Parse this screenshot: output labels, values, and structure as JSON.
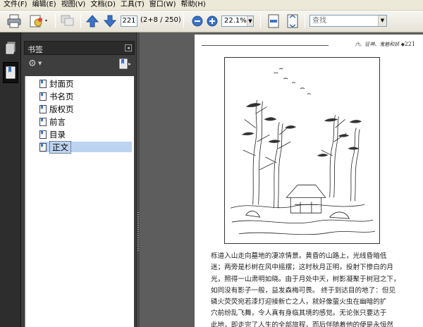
{
  "menu": [
    "文件(F)",
    "编辑(E)",
    "视图(V)",
    "文档(D)",
    "工具(T)",
    "窗口(W)",
    "帮助(H)"
  ],
  "toolbar": {
    "page_number": "221",
    "page_count": "(2+8 / 250)",
    "zoom": "22.1%",
    "search_placeholder": "查找"
  },
  "panel": {
    "title": "书签",
    "bookmarks": [
      {
        "label": "封面页",
        "selected": false
      },
      {
        "label": "书名页",
        "selected": false
      },
      {
        "label": "版权页",
        "selected": false
      },
      {
        "label": "前言",
        "selected": false
      },
      {
        "label": "目录",
        "selected": false
      },
      {
        "label": "正文",
        "selected": true
      }
    ]
  },
  "document": {
    "running_head": "六、征神、鬼魅和妖 ◆",
    "page_number": "221",
    "body_lines": [
      "栎道入山走向墓地的凄凉情景。黄昏的山路上，光线昏暗低",
      "迷；两旁是杉树在风中摇摆；这时秋月正明，投射下惨白的月",
      "光，照得一山肃明如晓。由于月处中天，树影凝聚于树冠之下，",
      "如同没有影子一般，益发森梅可畏。 终于到达目的地了：但见",
      "磷火荧荧宛若漆灯迎接新亡之人，就好像萤火虫在幽暗的扩",
      "穴前纷乱飞舞，令人真有身临其境的感觉。无论张只要达于",
      "此地，即走完了人生的全部旅程，而后伴随着他的便是永恒然"
    ]
  },
  "colors": {
    "menu_bg": "#ece9d8",
    "panel_bg": "#3e3e3e",
    "selection": "#bcd4f0",
    "doc_bg": "#5d5d5d"
  }
}
